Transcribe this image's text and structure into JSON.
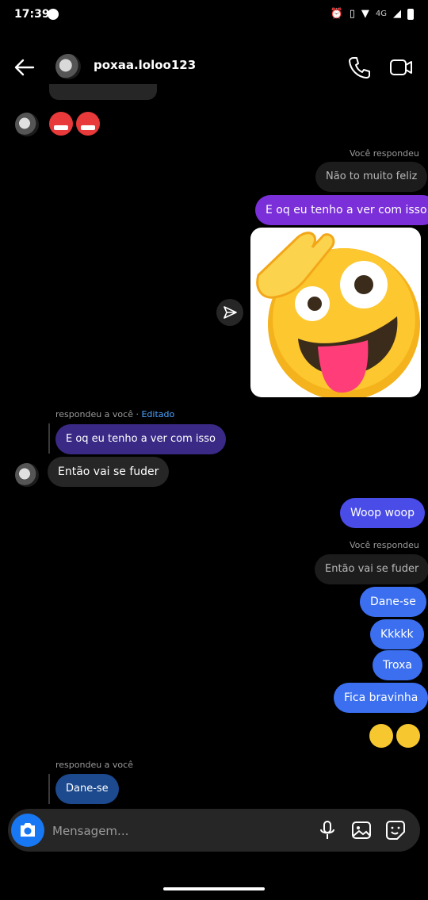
{
  "status_bar": {
    "time": "17:39",
    "network": "4G"
  },
  "header": {
    "username": "poxaa.loloo123",
    "chevron": "›"
  },
  "messages": {
    "you_replied_1": "Você respondeu",
    "quoted_1": "Não to muito feliz",
    "sent_1": "E oq eu tenho a ver com isso",
    "replied_to_you_1": "respondeu a você",
    "edited": "Editado",
    "quoted_2": "E oq eu tenho a ver com isso",
    "received_1": "Então vai se fuder",
    "sent_2": "Woop woop",
    "you_replied_2": "Você respondeu",
    "quoted_3": "Então vai se fuder",
    "sent_3": "Dane-se",
    "sent_4": "Kkkkk",
    "sent_5": "Troxa",
    "sent_6": "Fica bravinha",
    "replied_to_you_2": "respondeu a você",
    "quoted_4": "Dane-se"
  },
  "composer": {
    "placeholder": "Mensagem..."
  },
  "colors": {
    "purple": "#7a2fd9",
    "indigo": "#4a4ce8",
    "blue": "#3b6ff0",
    "camera": "#1877f2"
  }
}
